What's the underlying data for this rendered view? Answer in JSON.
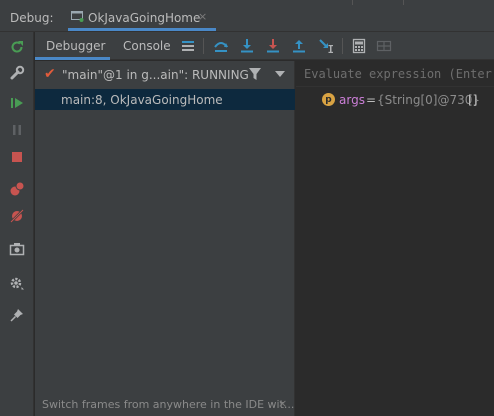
{
  "header": {
    "debug_label": "Debug:",
    "run_config": "OkJavaGoingHome",
    "close_glyph": "×"
  },
  "tabs": [
    {
      "label": "Debugger",
      "active": true
    },
    {
      "label": "Console",
      "active": false
    }
  ],
  "toolbar_icons": [
    "layout-icon",
    "show-execution-point-icon",
    "step-over-icon",
    "step-into-icon",
    "force-step-into-icon",
    "step-out-icon",
    "run-to-cursor-icon",
    "evaluate-expression-icon",
    "trace-icon"
  ],
  "left_toolbar_icons": [
    "rerun-icon",
    "modify-run-config-icon",
    "resume-icon",
    "pause-icon",
    "stop-icon",
    "view-breakpoints-icon",
    "mute-breakpoints-icon",
    "camera-icon",
    "settings-icon",
    "pin-icon"
  ],
  "frames": {
    "thread": {
      "check_glyph": "✔",
      "label": "\"main\"@1 in g...ain\": RUNNING"
    },
    "items": [
      {
        "label": "main:8, OkJavaGoingHome",
        "selected": true
      }
    ],
    "hint": "Switch frames from anywhere in the IDE wit...",
    "hint_close": "×"
  },
  "variables": {
    "evaluate_placeholder": "Evaluate expression (Enter)",
    "items": [
      {
        "badge": "p",
        "name": "args",
        "eq": "=",
        "value": "{String[0]@730}",
        "array": "[]"
      }
    ]
  },
  "colors": {
    "accent": "#4a88c7",
    "panel": "#3c3f41",
    "background": "#2b2b2b",
    "selection": "#0d293e",
    "green": "#499c54",
    "red": "#c75450",
    "blue": "#3592c4",
    "param_badge": "#d9a343",
    "var_name": "#cc7fd8"
  }
}
